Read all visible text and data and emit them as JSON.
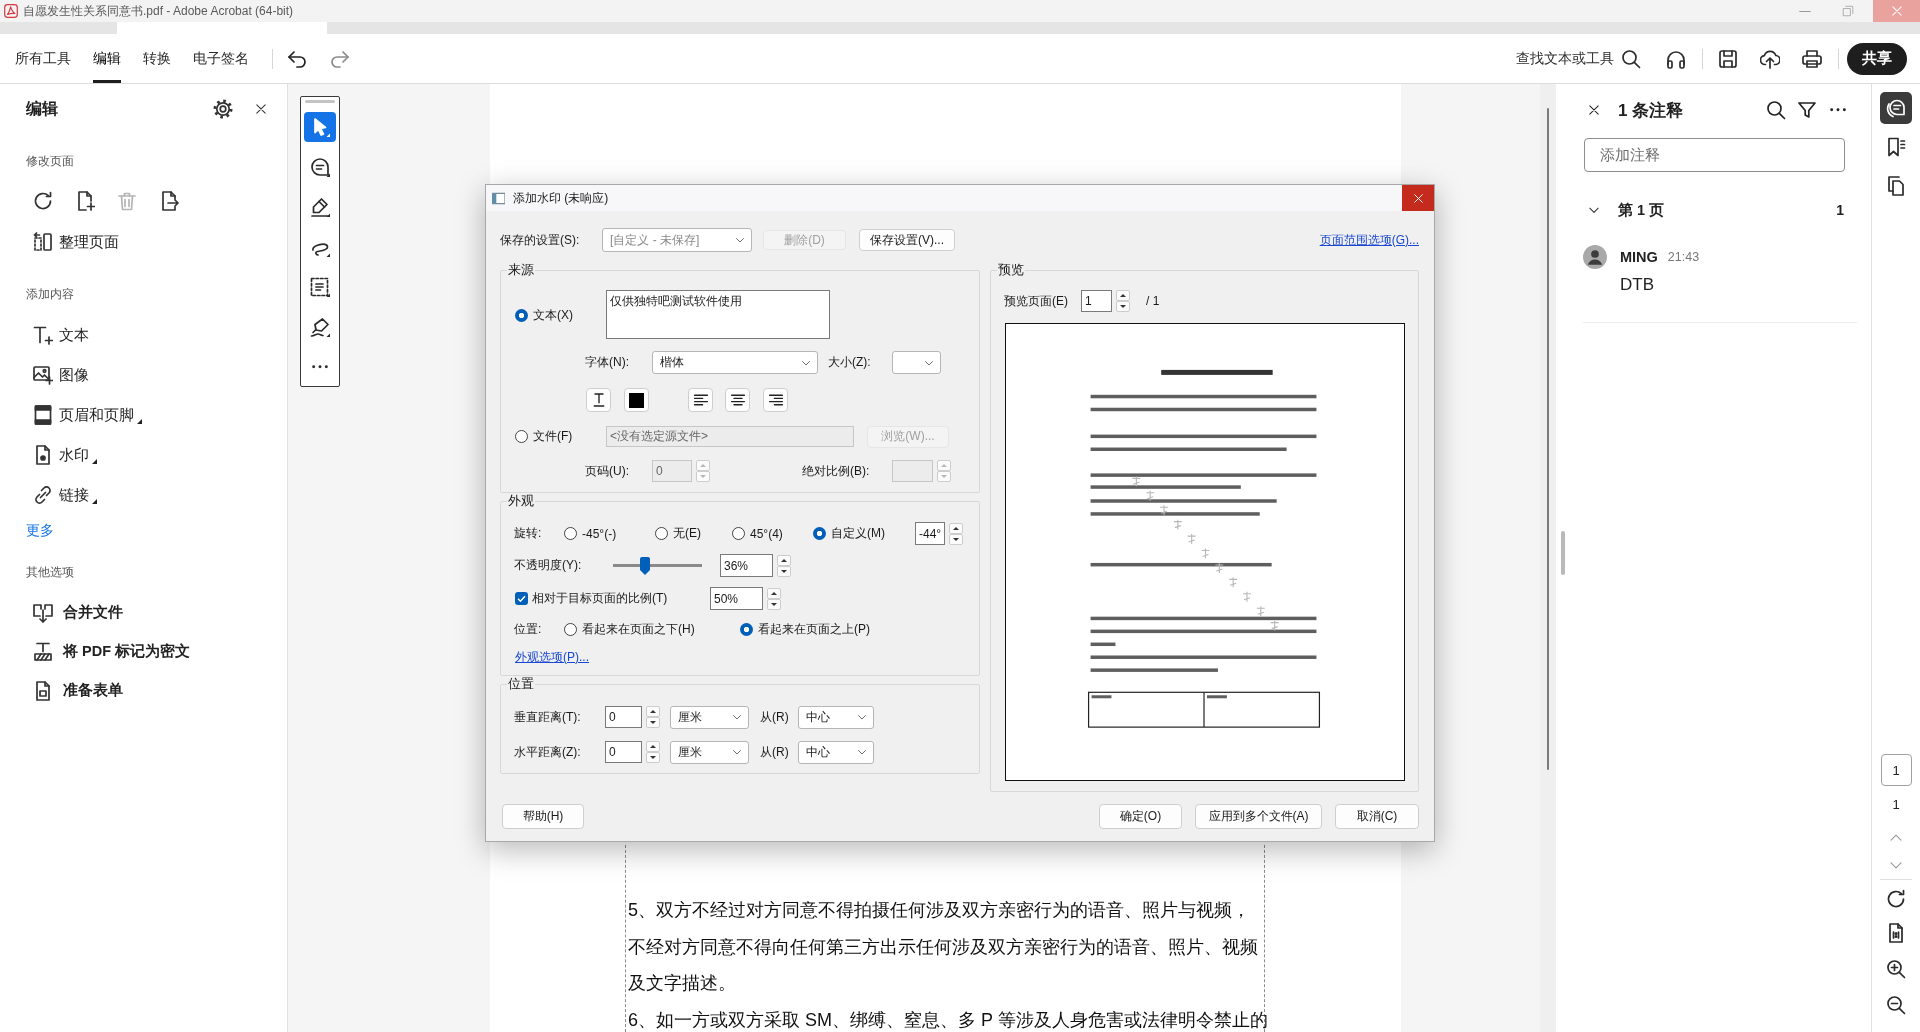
{
  "window": {
    "title": "自愿发生性关系同意书.pdf - Adobe Acrobat (64-bit)"
  },
  "toolbar": {
    "tabs": [
      {
        "label": "所有工具",
        "selected": false
      },
      {
        "label": "编辑",
        "selected": true
      },
      {
        "label": "转换",
        "selected": false
      },
      {
        "label": "电子签名",
        "selected": false
      }
    ],
    "history": [
      {
        "kind": "undo",
        "disabled": false
      },
      {
        "kind": "redo",
        "disabled": true
      }
    ],
    "search_label": "查找文本或工具",
    "share_button": "共享"
  },
  "edit_panel": {
    "title": "编辑",
    "sections": [
      {
        "kind": "modify",
        "label": "修改页面",
        "icon_actions": [
          {
            "kind": "rotate",
            "disabled": false
          },
          {
            "kind": "insert",
            "disabled": false
          },
          {
            "kind": "delete",
            "disabled": true
          },
          {
            "kind": "extract",
            "disabled": false
          }
        ],
        "items": [
          {
            "kind": "organize",
            "label": "整理页面",
            "has_menu": false
          }
        ]
      },
      {
        "kind": "add",
        "label": "添加内容",
        "items": [
          {
            "kind": "text",
            "label": "文本",
            "has_menu": false
          },
          {
            "kind": "image",
            "label": "图像",
            "has_menu": false
          },
          {
            "kind": "header-footer",
            "label": "页眉和页脚",
            "has_menu": true
          },
          {
            "kind": "watermark",
            "label": "水印",
            "has_menu": true
          },
          {
            "kind": "link",
            "label": "链接",
            "has_menu": true
          }
        ],
        "more_link": "更多"
      },
      {
        "kind": "other",
        "label": "其他选项",
        "items": [
          {
            "kind": "combine",
            "label": "合并文件",
            "has_menu": false
          },
          {
            "kind": "redact",
            "label": "将 PDF 标记为密文",
            "has_menu": false
          },
          {
            "kind": "form",
            "label": "准备表单",
            "has_menu": false
          }
        ]
      }
    ]
  },
  "tool_strip": [
    {
      "kind": "select",
      "selected": true,
      "has_menu": true
    },
    {
      "kind": "comment",
      "selected": false,
      "has_menu": true
    },
    {
      "kind": "highlight",
      "selected": false,
      "has_menu": true
    },
    {
      "kind": "draw",
      "selected": false,
      "has_menu": true
    },
    {
      "kind": "text-select",
      "selected": false,
      "has_menu": true
    },
    {
      "kind": "sign",
      "selected": false,
      "has_menu": true
    },
    {
      "kind": "more",
      "selected": false,
      "has_menu": false
    }
  ],
  "document": {
    "lines": [
      "5、双方不经过对方同意不得拍摄任何涉及双方亲密行为的语音、照片与视频，",
      "不经对方同意不得向任何第三方出示任何涉及双方亲密行为的语音、照片、视频",
      "及文字描述。",
      "6、如一方或双方采取 SM、绑缚、窒息、多 P 等涉及人身危害或法律明令禁止的"
    ]
  },
  "dialog": {
    "title": "添加水印 (未响应)",
    "saved_settings": {
      "label": "保存的设置(S):",
      "value": "[自定义 - 未保存]",
      "disabled": true
    },
    "top_buttons": [
      {
        "label": "删除(D)",
        "disabled": true
      },
      {
        "label": "保存设置(V)...",
        "disabled": false
      }
    ],
    "page_range_link": "页面范围选项(G)...",
    "source": {
      "title": "来源",
      "options": [
        {
          "label": "文本(X)",
          "selected": true
        },
        {
          "label": "文件(F)",
          "selected": false
        }
      ],
      "text_value": "仅供独特吧测试软件使用",
      "font_label": "字体(N):",
      "font_value": "楷体",
      "size_label": "大小(Z):",
      "color_swatch": {
        "color": "#000000"
      },
      "file_value": "<没有选定源文件>",
      "browse_button": {
        "label": "浏览(W)...",
        "disabled": true
      },
      "page_label": "页码(U):",
      "page_value": "0",
      "scale_label": "绝对比例(B):"
    },
    "appearance": {
      "title": "外观",
      "rotation_label": "旋转:",
      "rotation_options": [
        {
          "label": "-45°(-)",
          "selected": false
        },
        {
          "label": "无(E)",
          "selected": false
        },
        {
          "label": "45°(4)",
          "selected": false
        },
        {
          "label": "自定义(M)",
          "selected": true
        }
      ],
      "rotation_value": "-44°",
      "opacity_label": "不透明度(Y):",
      "opacity": {
        "level": 0.36,
        "value": "36%"
      },
      "relative_scale": {
        "label": "相对于目标页面的比例(T)",
        "checked": true,
        "value": "50%"
      },
      "position_label": "位置:",
      "position_options": [
        {
          "label": "看起来在页面之下(H)",
          "selected": false
        },
        {
          "label": "看起来在页面之上(P)",
          "selected": true
        }
      ],
      "options_link": "外观选项(P)..."
    },
    "position": {
      "title": "位置",
      "rows": [
        {
          "label": "垂直距离(T):",
          "value": "0",
          "unit": "厘米",
          "from_label": "从(R)",
          "from_value": "中心"
        },
        {
          "label": "水平距离(Z):",
          "value": "0",
          "unit": "厘米",
          "from_label": "从(R)",
          "from_value": "中心"
        }
      ]
    },
    "preview": {
      "title": "预览",
      "page_label": "预览页面(E)",
      "page_value": "1",
      "page_total": "/ 1"
    },
    "help_button": "帮助(H)",
    "buttons": [
      "确定(O)",
      "应用到多个文件(A)",
      "取消(C)"
    ]
  },
  "comments_panel": {
    "title": "1 条注释",
    "placeholder": "添加注释",
    "page_group": {
      "label": "第 1 页",
      "count": "1",
      "expanded": true
    },
    "comments": [
      {
        "author": "MING",
        "time": "21:43",
        "text": "DTB"
      }
    ]
  },
  "right_rail": {
    "panels": [
      {
        "kind": "comments",
        "selected": true
      },
      {
        "kind": "bookmarks",
        "selected": false
      },
      {
        "kind": "pages",
        "selected": false
      }
    ],
    "page_current": "1",
    "page_total": "1",
    "page_nav": [
      {
        "kind": "previous",
        "disabled": true
      },
      {
        "kind": "next",
        "disabled": true
      }
    ]
  }
}
